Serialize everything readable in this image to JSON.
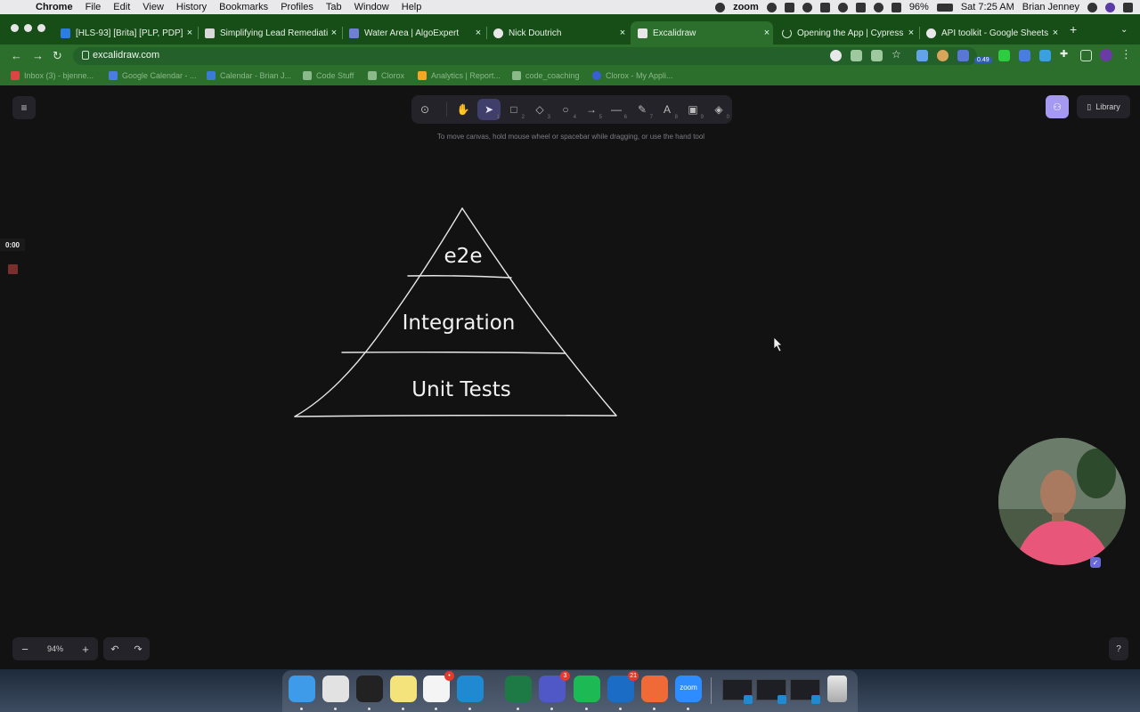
{
  "menubar": {
    "app_name": "Chrome",
    "menus": [
      "File",
      "Edit",
      "View",
      "History",
      "Bookmarks",
      "Profiles",
      "Tab",
      "Window",
      "Help"
    ],
    "zoom_label": "zoom",
    "battery": "96%",
    "clock": "Sat 7:25 AM",
    "user": "Brian Jenney"
  },
  "browser": {
    "tabs": [
      {
        "title": "[HLS-93] [Brita] [PLP, PDP]",
        "icon": "jira-icon",
        "color": "#2d7de0"
      },
      {
        "title": "Simplifying Lead Remediation",
        "icon": "doc-icon",
        "color": "#d9d9d9"
      },
      {
        "title": "Water Area | AlgoExpert",
        "icon": "algoexpert-icon",
        "color": "#6f7fd6"
      },
      {
        "title": "Nick Doutrich",
        "icon": "github-icon",
        "color": "#e8e8e8"
      },
      {
        "title": "Excalidraw",
        "icon": "excalidraw-icon",
        "color": "#e8e8e8"
      },
      {
        "title": "Opening the App | Cypress Do",
        "icon": "loading-icon",
        "color": "#cfe6cf"
      },
      {
        "title": "API toolkit - Google Sheets",
        "icon": "google-icon",
        "color": "#e8e8e8"
      }
    ],
    "url": "excalidraw.com",
    "extension_badge": "0.49",
    "bookmarks": [
      {
        "label": "Inbox (3) - bjenne...",
        "color": "#d44"
      },
      {
        "label": "Google Calendar - ...",
        "color": "#4a7de0"
      },
      {
        "label": "Calendar - Brian J...",
        "color": "#3a7bd5"
      },
      {
        "label": "Code Stuff",
        "color": "#8ab98a"
      },
      {
        "label": "Clorox",
        "color": "#8ab98a"
      },
      {
        "label": "Analytics | Report...",
        "color": "#f5a623"
      },
      {
        "label": "code_coaching",
        "color": "#8ab98a"
      },
      {
        "label": "Clorox - My Appli...",
        "color": "#3a5fd5"
      }
    ]
  },
  "excalidraw": {
    "library_label": "Library",
    "hint": "To move canvas, hold mouse wheel or spacebar while dragging, or use the hand tool",
    "tools": [
      {
        "name": "lock-icon",
        "glyph": "⊙",
        "num": ""
      },
      {
        "name": "hand-icon",
        "glyph": "✋",
        "num": ""
      },
      {
        "name": "selection-icon",
        "glyph": "➤",
        "num": "1"
      },
      {
        "name": "rectangle-icon",
        "glyph": "□",
        "num": "2"
      },
      {
        "name": "diamond-icon",
        "glyph": "◇",
        "num": "3"
      },
      {
        "name": "ellipse-icon",
        "glyph": "○",
        "num": "4"
      },
      {
        "name": "arrow-icon",
        "glyph": "→",
        "num": "5"
      },
      {
        "name": "line-icon",
        "glyph": "—",
        "num": "6"
      },
      {
        "name": "pencil-icon",
        "glyph": "✎",
        "num": "7"
      },
      {
        "name": "text-icon",
        "glyph": "A",
        "num": "8"
      },
      {
        "name": "image-icon",
        "glyph": "▣",
        "num": "9"
      },
      {
        "name": "eraser-icon",
        "glyph": "◈",
        "num": "0"
      }
    ],
    "zoom_value": "94%",
    "timer": "0:00",
    "pyramid_labels": {
      "top": "e2e",
      "middle": "Integration",
      "bottom": "Unit Tests"
    }
  },
  "dock": {
    "apps": [
      {
        "name": "finder-icon",
        "color": "#3d9be9",
        "badge": ""
      },
      {
        "name": "chrome-icon",
        "color": "#e2e2e2",
        "badge": ""
      },
      {
        "name": "terminal-icon",
        "color": "#222222",
        "badge": ""
      },
      {
        "name": "notes-icon",
        "color": "#f4e27a",
        "badge": ""
      },
      {
        "name": "slack-icon",
        "color": "#f4f4f4",
        "badge": "•"
      },
      {
        "name": "vscode-icon",
        "color": "#1f8ad2",
        "badge": ""
      },
      {
        "name": "excel-icon",
        "color": "#1d7a45",
        "badge": ""
      },
      {
        "name": "teams-icon",
        "color": "#5058c8",
        "badge": "3"
      },
      {
        "name": "spotify-icon",
        "color": "#1db954",
        "badge": ""
      },
      {
        "name": "outlook-icon",
        "color": "#1a6cc4",
        "badge": "21"
      },
      {
        "name": "postman-icon",
        "color": "#ef6a37",
        "badge": ""
      },
      {
        "name": "zoom-icon",
        "color": "#2d8cff",
        "badge": "",
        "label": "zoom"
      }
    ]
  }
}
